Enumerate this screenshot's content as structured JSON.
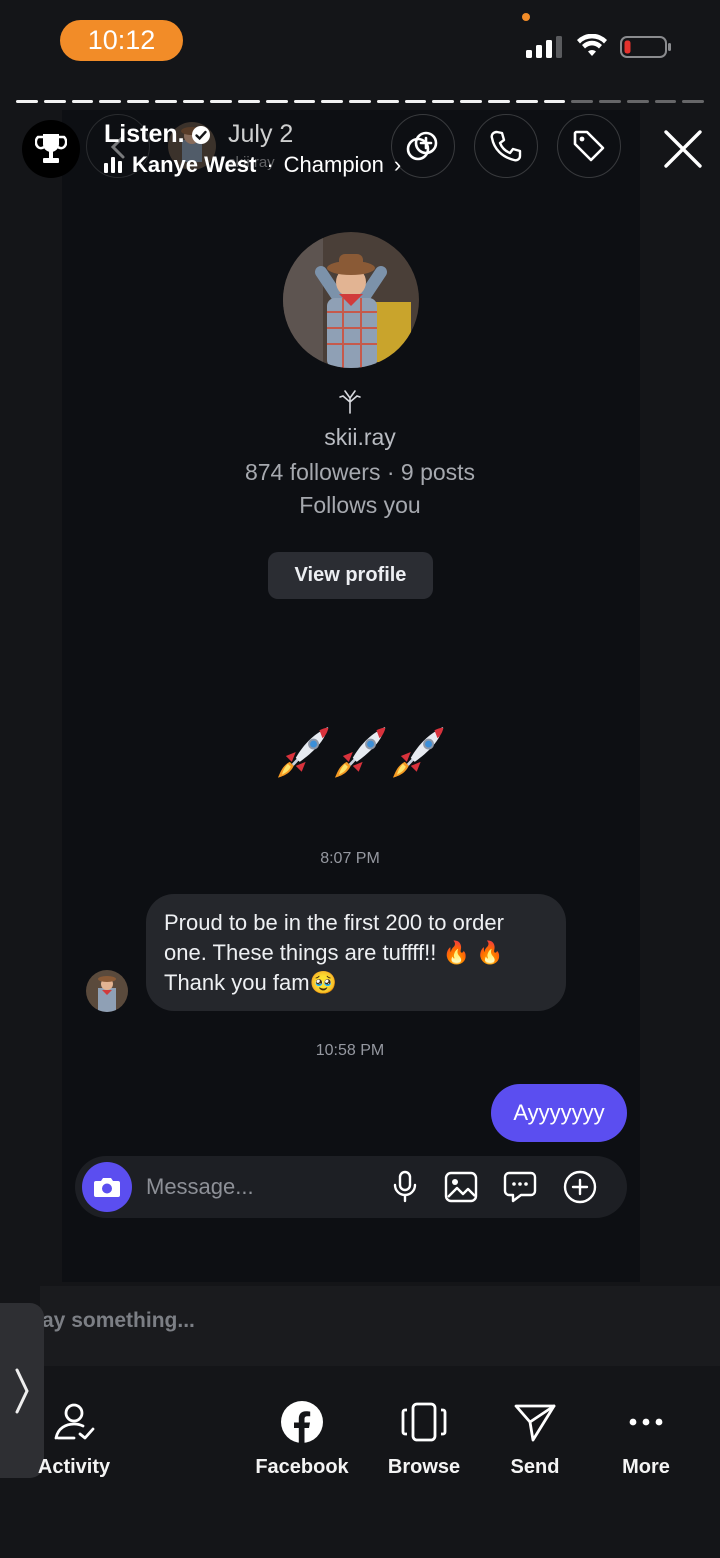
{
  "status_bar": {
    "time": "10:12"
  },
  "story": {
    "title": "Listen.",
    "date": "July 2",
    "ghost_username": "skii.ray",
    "music_artist": "Kanye West",
    "music_song": "Champion",
    "progress_segments_total": 25,
    "progress_segments_done": 20
  },
  "dm": {
    "profile": {
      "username": "skii.ray",
      "stats": "874 followers · 9 posts",
      "follows_you": "Follows you",
      "view_profile_label": "View profile"
    },
    "messages": [
      {
        "type": "timestamp",
        "text": "8:07 PM"
      },
      {
        "type": "incoming",
        "text": "Proud to be in the first 200 to order one. These things are tuffff!! 🔥 🔥 Thank you fam🥹"
      },
      {
        "type": "timestamp",
        "text": "10:58 PM"
      },
      {
        "type": "outgoing",
        "text": "Ayyyyyyy"
      }
    ],
    "composer_placeholder": "Message..."
  },
  "reply": {
    "placeholder": "ay something..."
  },
  "bottom_nav": [
    {
      "label": "Activity",
      "icon": "activity-icon"
    },
    {
      "label": "Facebook",
      "icon": "facebook-icon"
    },
    {
      "label": "Browse",
      "icon": "browse-icon"
    },
    {
      "label": "Send",
      "icon": "send-icon"
    },
    {
      "label": "More",
      "icon": "more-icon"
    }
  ],
  "colors": {
    "status_pill": "#f28c28",
    "accent_purple": "#5b4ef0",
    "panel_bg": "#0d0f13",
    "battery_low": "#e5322d"
  }
}
